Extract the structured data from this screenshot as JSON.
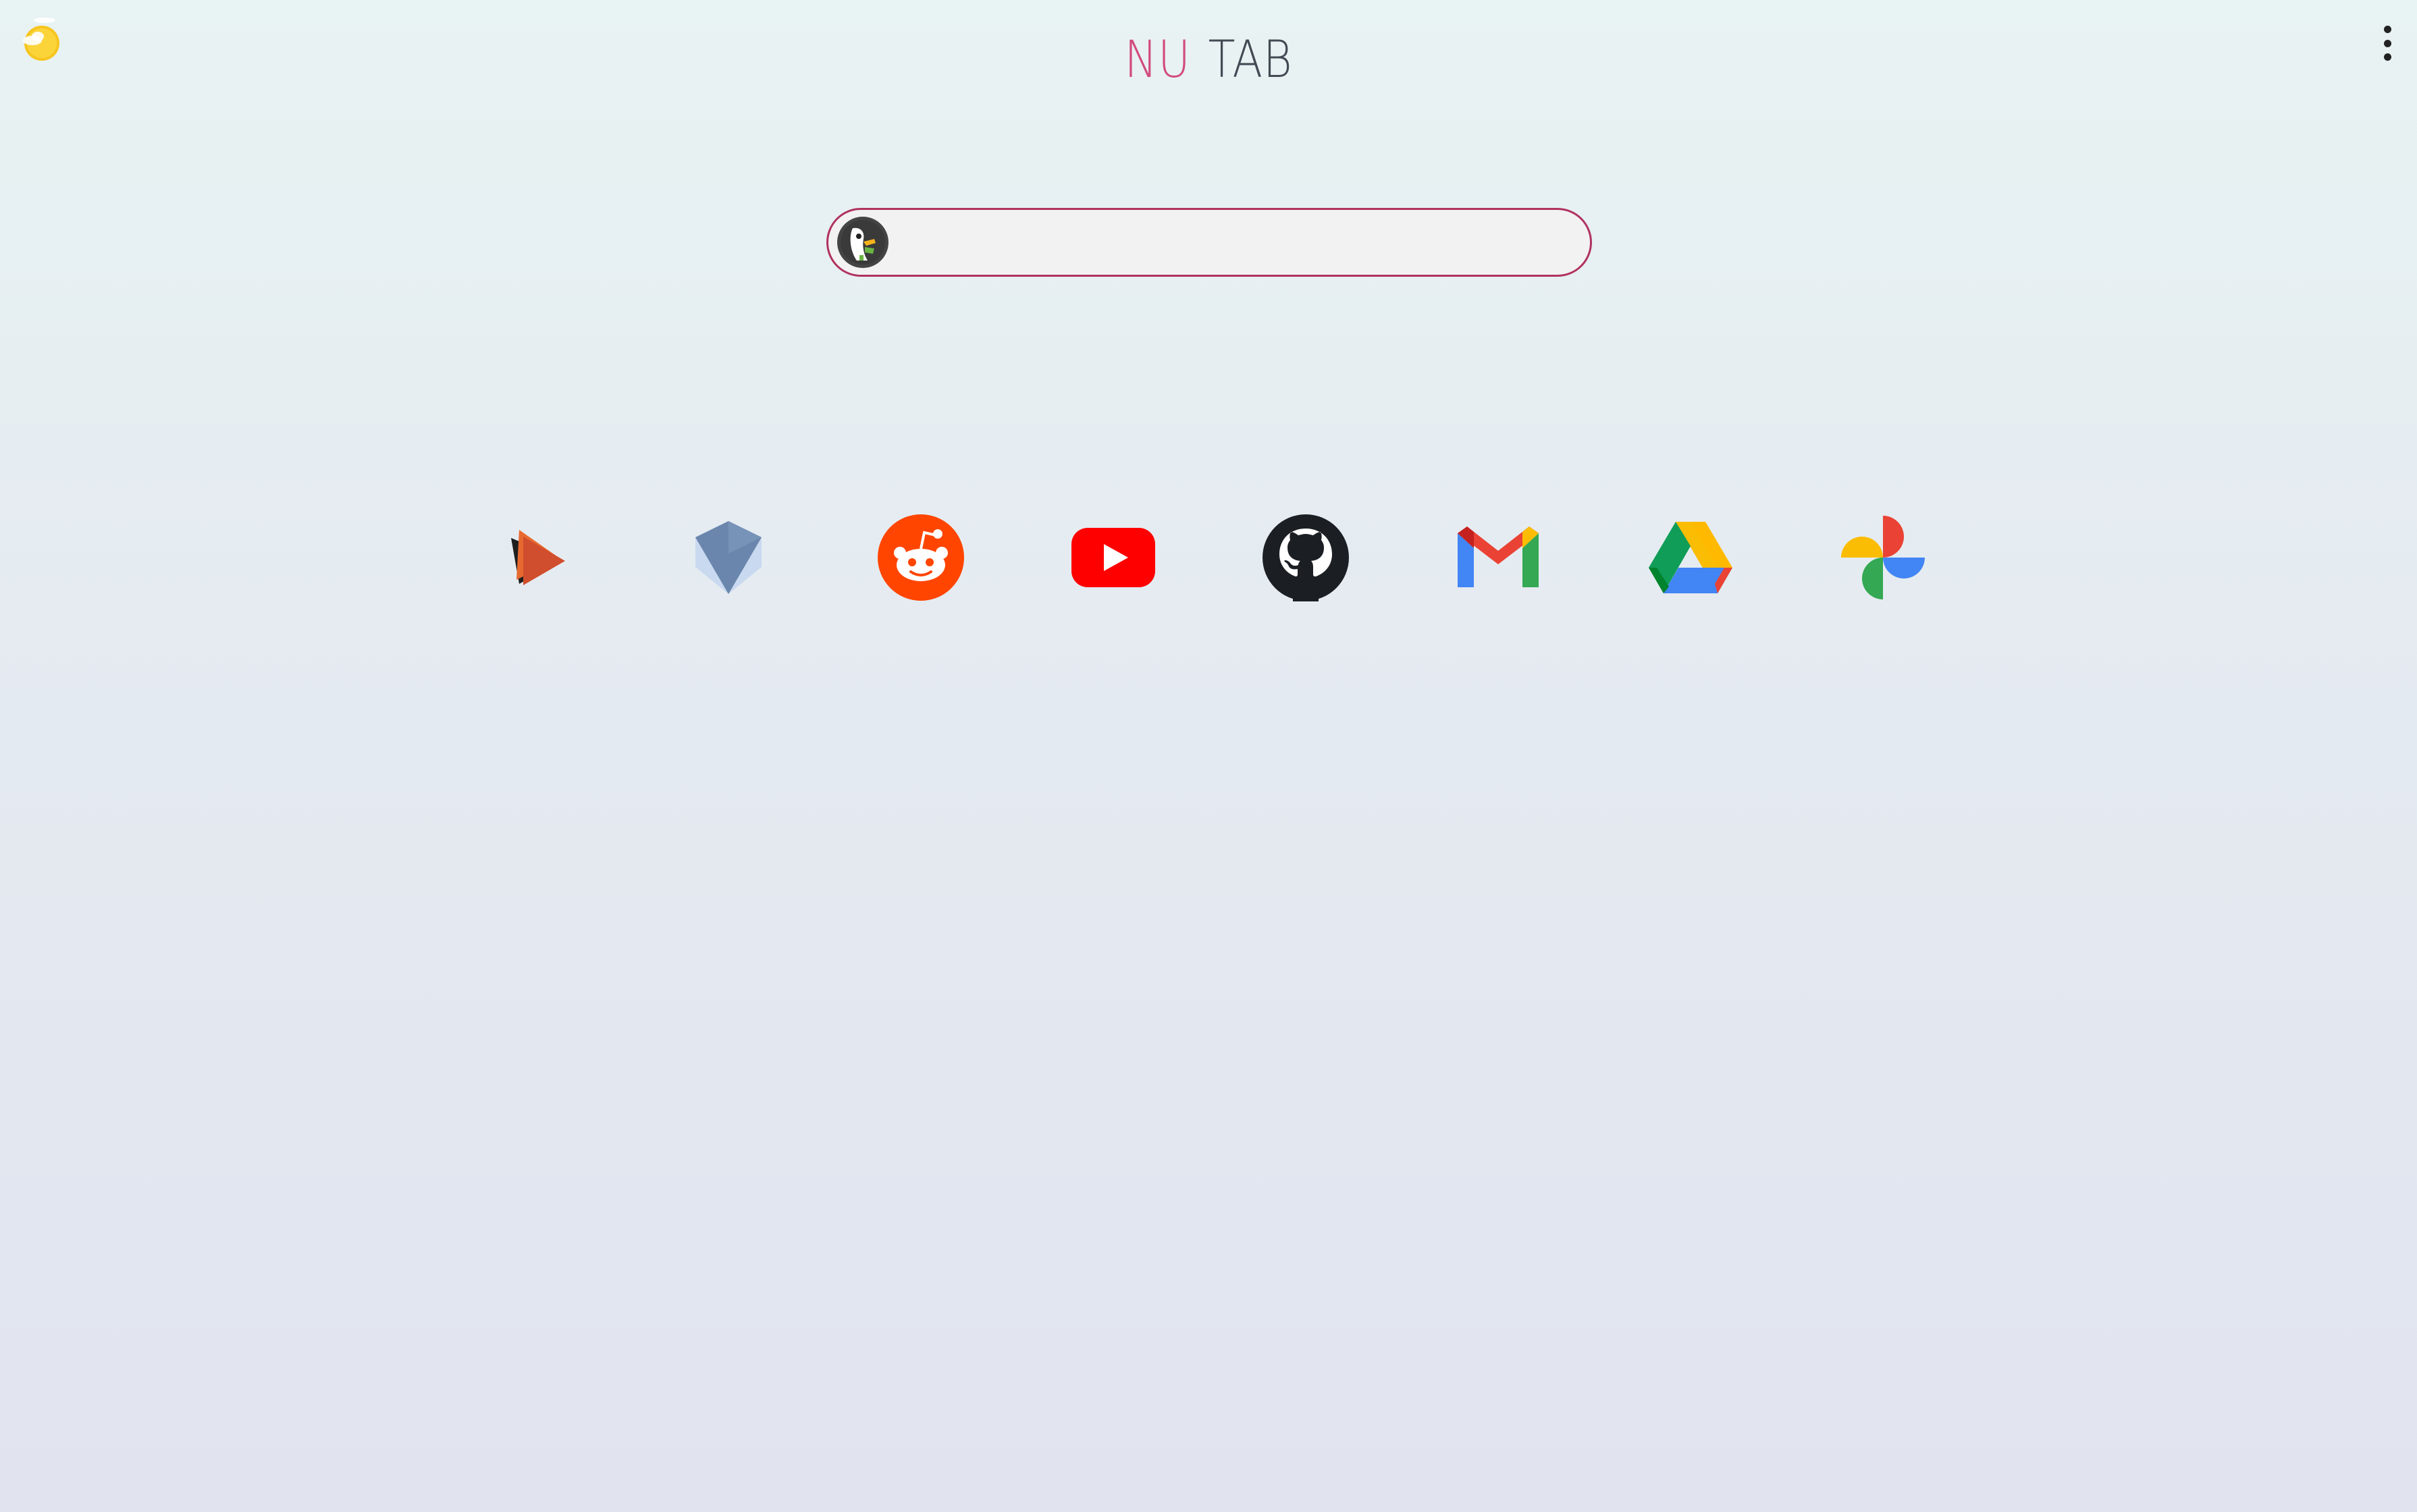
{
  "brand": {
    "part1": "NU",
    "part2": "TAB"
  },
  "weather": {
    "icon": "sun-cloud-icon"
  },
  "menu": {
    "icon": "more-vertical-icon"
  },
  "search": {
    "engine_icon": "duckduckgo-icon",
    "value": "",
    "placeholder": ""
  },
  "shortcuts": [
    {
      "icon": "play-triangles-icon"
    },
    {
      "icon": "blue-gem-icon"
    },
    {
      "icon": "reddit-icon"
    },
    {
      "icon": "youtube-icon"
    },
    {
      "icon": "github-icon"
    },
    {
      "icon": "gmail-icon"
    },
    {
      "icon": "google-drive-icon"
    },
    {
      "icon": "google-photos-icon"
    }
  ],
  "colors": {
    "brand_accent": "#d24c7b",
    "brand_text": "#434a54",
    "search_border": "#b0325f",
    "search_bg": "#f2f2f2"
  }
}
